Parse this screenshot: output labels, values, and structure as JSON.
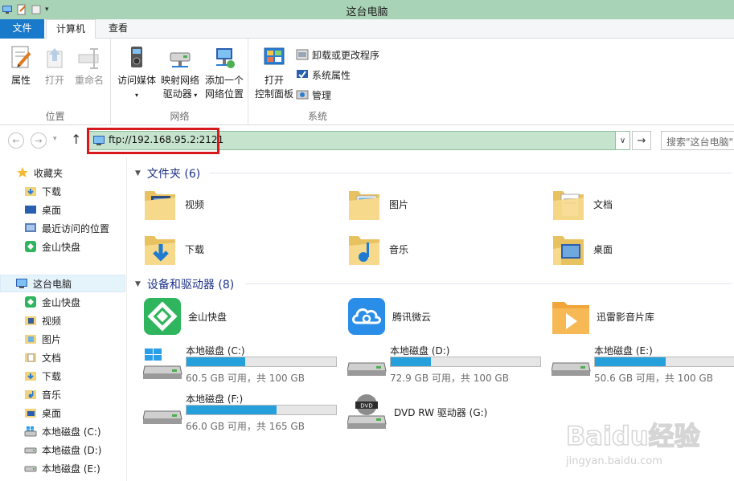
{
  "window": {
    "title": "这台电脑"
  },
  "tabs": {
    "file": "文件",
    "computer": "计算机",
    "view": "查看"
  },
  "ribbon": {
    "location": {
      "label": "位置",
      "properties": "属性",
      "open": "打开",
      "rename": "重命名"
    },
    "network": {
      "label": "网络",
      "media_line1": "访问媒体",
      "map_line1": "映射网络",
      "map_line2": "驱动器",
      "add_line1": "添加一个",
      "add_line2": "网络位置"
    },
    "system": {
      "label": "系统",
      "control_line1": "打开",
      "control_line2": "控制面板",
      "uninstall": "卸载或更改程序",
      "sysprops": "系统属性",
      "manage": "管理"
    }
  },
  "address": {
    "value": "ftp://192.168.95.2:2121",
    "search_placeholder": "搜索\"这台电脑\""
  },
  "navpane": {
    "favorites": "收藏夹",
    "downloads": "下载",
    "desktop": "桌面",
    "recent": "最近访问的位置",
    "kuaipan": "金山快盘",
    "thispc": "这台电脑",
    "pc_kuaipan": "金山快盘",
    "videos": "视频",
    "pictures": "图片",
    "documents": "文档",
    "pc_downloads": "下载",
    "music": "音乐",
    "pc_desktop": "桌面",
    "drive_c": "本地磁盘 (C:)",
    "drive_d": "本地磁盘 (D:)",
    "drive_e": "本地磁盘 (E:)"
  },
  "folders": {
    "header": "文件夹 (6)",
    "items": [
      "视频",
      "图片",
      "文档",
      "下载",
      "音乐",
      "桌面"
    ]
  },
  "devices": {
    "header": "设备和驱动器 (8)",
    "apps": [
      "金山快盘",
      "腾讯微云",
      "迅雷影音片库"
    ],
    "drives": [
      {
        "name": "本地磁盘 (C:)",
        "free": "60.5 GB 可用，共 100 GB",
        "used_fraction": 0.395
      },
      {
        "name": "本地磁盘 (D:)",
        "free": "72.9 GB 可用，共 100 GB",
        "used_fraction": 0.271
      },
      {
        "name": "本地磁盘 (E:)",
        "free": "50.6 GB 可用，共 100 GB",
        "used_fraction": 0.494
      },
      {
        "name": "本地磁盘 (F:)",
        "free": "66.0 GB 可用，共 165 GB",
        "used_fraction": 0.6
      }
    ],
    "dvd": "DVD RW 驱动器 (G:)"
  },
  "watermark": {
    "brand": "Baidu经验",
    "url": "jingyan.baidu.com"
  },
  "colors": {
    "titlebar": "#a9d3b6",
    "file_tab": "#1979ca",
    "address_bg": "#c6e4cd",
    "highlight": "#d7191e",
    "drive_fill": "#26a0da",
    "section_text": "#1e3287"
  }
}
